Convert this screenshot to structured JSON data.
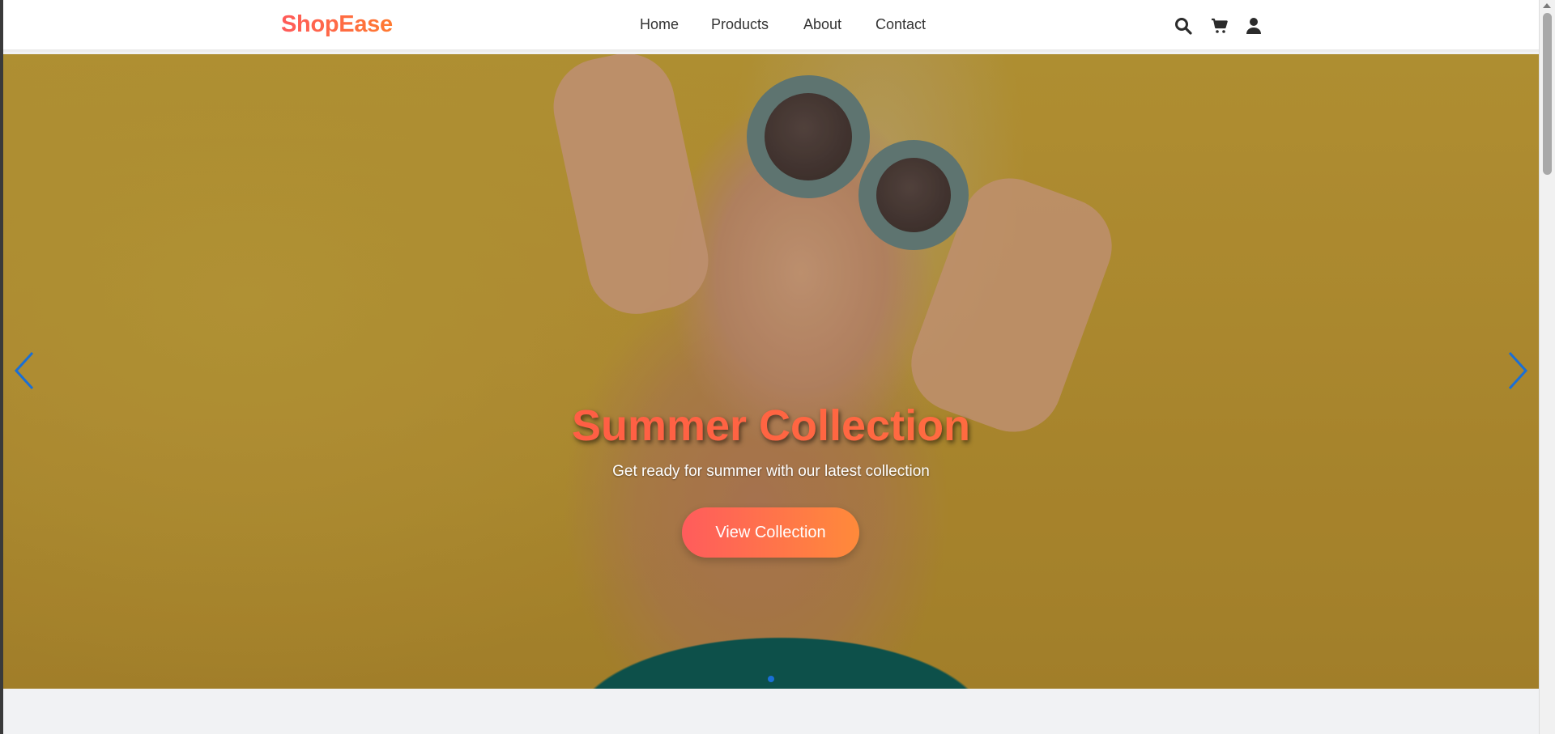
{
  "header": {
    "logo": "ShopEase",
    "nav": [
      "Home",
      "Products",
      "About",
      "Contact"
    ],
    "icons": [
      "search-icon",
      "cart-icon",
      "user-icon"
    ]
  },
  "hero": {
    "title": "Summer Collection",
    "subtitle": "Get ready for summer with our latest collection",
    "cta_label": "View Collection",
    "slide_count": 1,
    "active_slide": 1
  },
  "colors": {
    "brand_start": "#ff5a5a",
    "brand_end": "#ff7a30",
    "nav_text": "#333333",
    "arrow": "#1a6fd6",
    "section_bg": "#f1f2f4"
  }
}
